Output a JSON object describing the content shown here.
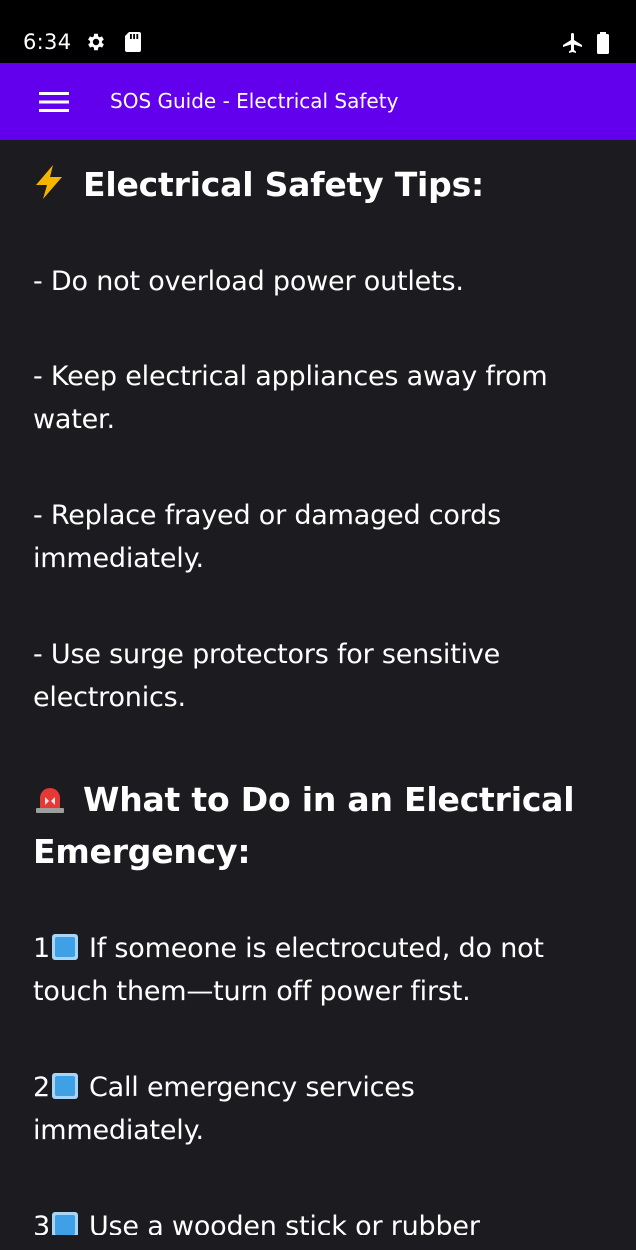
{
  "status_bar": {
    "time": "6:34",
    "left_icons": [
      "gear-icon",
      "sd-card-icon"
    ],
    "right_icons": [
      "airplane-icon",
      "battery-icon"
    ]
  },
  "app_bar": {
    "title": "SOS Guide - Electrical Safety",
    "menu_icon": "hamburger-menu-icon",
    "color": "#6200ee"
  },
  "content": {
    "section1": {
      "icon": "lightning-bolt-icon",
      "heading": "Electrical Safety Tips:",
      "tips": [
        [
          "- Do not overload power outlets."
        ],
        [
          "- Keep electrical appliances away from",
          "water."
        ],
        [
          "- Replace frayed or damaged cords",
          "immediately."
        ],
        [
          "- Use surge protectors for sensitive",
          "electronics."
        ]
      ]
    },
    "section2": {
      "icon": "siren-icon",
      "heading_line1": "What to Do in an Electrical",
      "heading_line2": "Emergency:",
      "steps": [
        {
          "number": "1",
          "lines": [
            "If someone is electrocuted, do not",
            "touch them—turn off power first."
          ]
        },
        {
          "number": "2",
          "lines": [
            "Call emergency services",
            "immediately."
          ]
        },
        {
          "number": "3",
          "lines": [
            "Use a wooden stick or rubber"
          ]
        }
      ]
    }
  },
  "colors": {
    "background": "#1c1b1f",
    "status_bar": "#000000",
    "text": "#ffffff"
  }
}
